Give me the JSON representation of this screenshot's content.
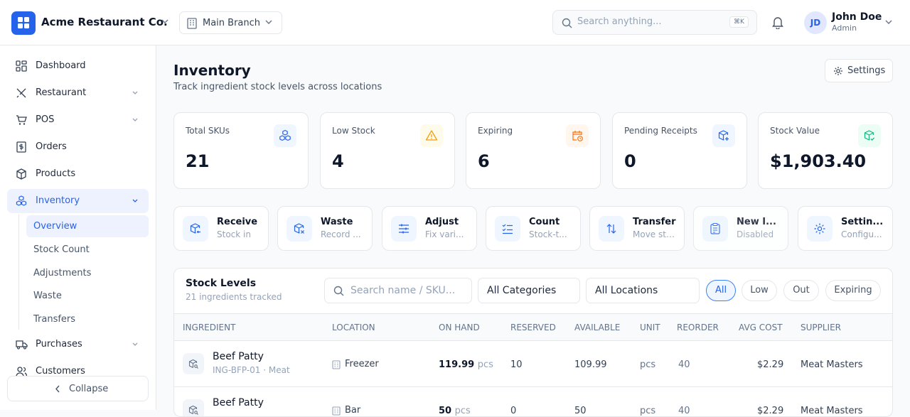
{
  "header": {
    "company": "Acme Restaurant Co.",
    "branch": "Main Branch",
    "search_placeholder": "Search anything...",
    "search_shortcut": "⌘K",
    "user": {
      "initials": "JD",
      "name": "John Doe",
      "role": "Admin"
    }
  },
  "sidebar": {
    "items": [
      {
        "label": "Dashboard",
        "icon": "grid-icon"
      },
      {
        "label": "Restaurant",
        "icon": "utensils-icon"
      },
      {
        "label": "POS",
        "icon": "cart-icon"
      },
      {
        "label": "Orders",
        "icon": "receipt-icon"
      },
      {
        "label": "Products",
        "icon": "box-icon"
      },
      {
        "label": "Inventory",
        "icon": "boxes-icon"
      },
      {
        "label": "Purchases",
        "icon": "truck-icon"
      },
      {
        "label": "Customers",
        "icon": "users-icon"
      }
    ],
    "inventory_sub": [
      "Overview",
      "Stock Count",
      "Adjustments",
      "Waste",
      "Transfers"
    ],
    "collapse_label": "Collapse"
  },
  "page": {
    "title": "Inventory",
    "subtitle": "Track ingredient stock levels across locations",
    "settings_label": "Settings"
  },
  "kpis": [
    {
      "label": "Total SKUs",
      "value": "21",
      "icon": "boxes-icon",
      "color": "#2563eb"
    },
    {
      "label": "Low Stock",
      "value": "4",
      "icon": "warning-icon",
      "color": "#f59e0b"
    },
    {
      "label": "Expiring",
      "value": "6",
      "icon": "calendar-clock-icon",
      "color": "#f97316"
    },
    {
      "label": "Pending Receipts",
      "value": "0",
      "icon": "package-plus-icon",
      "color": "#2563eb"
    },
    {
      "label": "Stock Value",
      "value": "$1,903.40",
      "icon": "package-check-icon",
      "color": "#10b981"
    }
  ],
  "actions": [
    {
      "title": "Receive",
      "subtitle": "Stock in",
      "icon": "package-in-icon"
    },
    {
      "title": "Waste",
      "subtitle": "Record ...",
      "icon": "package-x-icon"
    },
    {
      "title": "Adjust",
      "subtitle": "Fix vari...",
      "icon": "sliders-icon"
    },
    {
      "title": "Count",
      "subtitle": "Stock-t...",
      "icon": "list-check-icon"
    },
    {
      "title": "Transfer",
      "subtitle": "Move stock",
      "icon": "arrows-updown-icon"
    },
    {
      "title": "New I...",
      "subtitle": "Disabled",
      "icon": "clipboard-icon"
    },
    {
      "title": "Settin...",
      "subtitle": "Configu...",
      "icon": "gear-icon"
    }
  ],
  "stock": {
    "title": "Stock Levels",
    "subtitle": "21 ingredients tracked",
    "search_placeholder": "Search name / SKU...",
    "category": "All Categories",
    "location": "All Locations",
    "filters": [
      "All",
      "Low",
      "Out",
      "Expiring"
    ],
    "columns": [
      "INGREDIENT",
      "LOCATION",
      "ON HAND",
      "RESERVED",
      "AVAILABLE",
      "UNIT",
      "REORDER",
      "AVG COST",
      "SUPPLIER"
    ],
    "rows": [
      {
        "name": "Beef Patty",
        "sku": "ING-BFP-01 · Meat",
        "location": "Freezer",
        "on_hand": "119.99",
        "unit_small": "pcs",
        "reserved": "10",
        "available": "109.99",
        "unit": "pcs",
        "reorder": "40",
        "cost": "$2.29",
        "supplier": "Meat Masters"
      },
      {
        "name": "Beef Patty",
        "sku": "",
        "location": "Bar",
        "on_hand": "50",
        "unit_small": "pcs",
        "reserved": "0",
        "available": "50",
        "unit": "pcs",
        "reorder": "40",
        "cost": "$2.29",
        "supplier": "Meat Masters"
      }
    ]
  }
}
